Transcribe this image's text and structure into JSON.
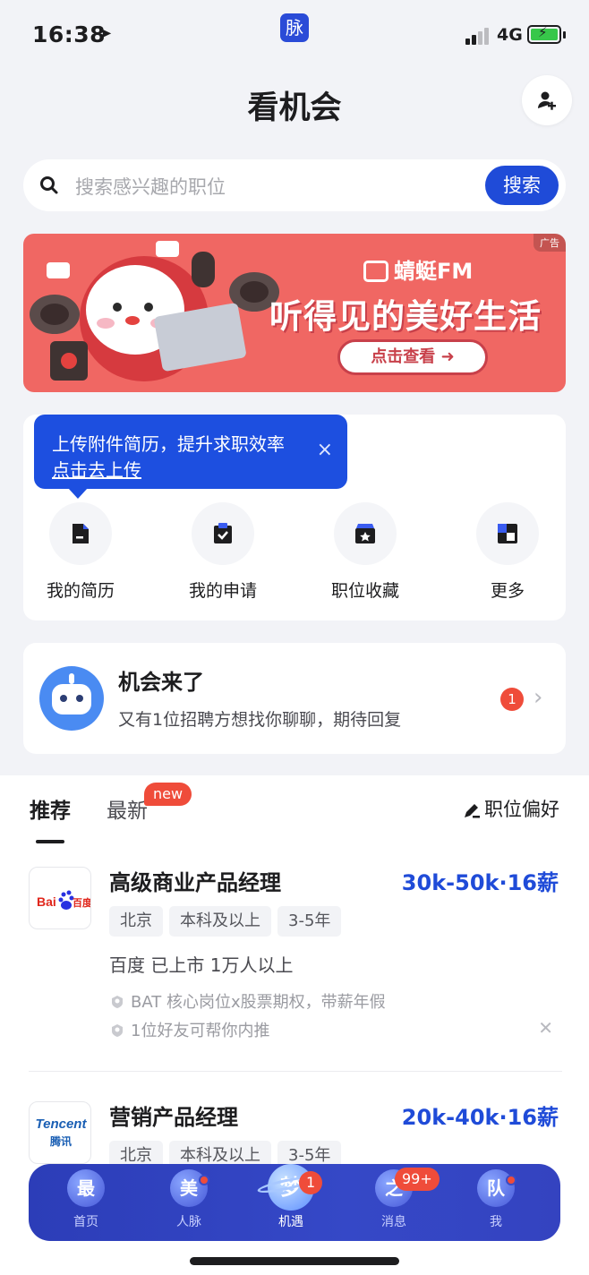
{
  "status": {
    "time": "16:38",
    "network": "4G",
    "app_badge": "脉"
  },
  "header": {
    "title": "看机会"
  },
  "search": {
    "placeholder": "搜索感兴趣的职位",
    "button": "搜索"
  },
  "banner": {
    "ad_label": "广告",
    "brand": "蜻蜓FM",
    "slogan": "听得见的美好生活",
    "cta": "点击查看"
  },
  "tooltip": {
    "line1": "上传附件简历，提升求职效率",
    "line2": "点击去上传",
    "close": "×"
  },
  "quick": {
    "items": [
      {
        "label": "我的简历",
        "icon": "resume-icon"
      },
      {
        "label": "我的申请",
        "icon": "clipboard-check-icon"
      },
      {
        "label": "职位收藏",
        "icon": "bookmark-box-icon"
      },
      {
        "label": "更多",
        "icon": "more-icon"
      }
    ]
  },
  "opportunity": {
    "title": "机会来了",
    "subtitle": "又有1位招聘方想找你聊聊，期待回复",
    "count": "1"
  },
  "feed": {
    "tab_recommend": "推荐",
    "tab_latest": "最新",
    "new_badge": "new",
    "preference": "职位偏好",
    "jobs": [
      {
        "logo_text": "Bai度百度",
        "title": "高级商业产品经理",
        "salary": "30k-50k·16薪",
        "tags": [
          "北京",
          "本科及以上",
          "3-5年"
        ],
        "company": "百度 已上市 1万人以上",
        "perk1": "BAT 核心岗位x股票期权，带薪年假",
        "perk2": "1位好友可帮你内推"
      },
      {
        "logo_text_top": "Tencent",
        "logo_text_bottom": "腾讯",
        "title": "营销产品经理",
        "salary": "20k-40k·16薪",
        "tags": [
          "北京",
          "本科及以上",
          "3-5年"
        ]
      }
    ]
  },
  "tabbar": {
    "items": [
      {
        "glyph": "最",
        "label": "首页"
      },
      {
        "glyph": "美",
        "label": "人脉"
      },
      {
        "glyph": "梦",
        "label": "机遇",
        "badge": "1"
      },
      {
        "glyph": "之",
        "label": "消息",
        "badge": "99+"
      },
      {
        "glyph": "队",
        "label": "我"
      }
    ]
  },
  "colors": {
    "accent": "#1f4bd8",
    "badge": "#ef4c3a",
    "tabbar": "#3548c7",
    "banner": "#f06763"
  }
}
